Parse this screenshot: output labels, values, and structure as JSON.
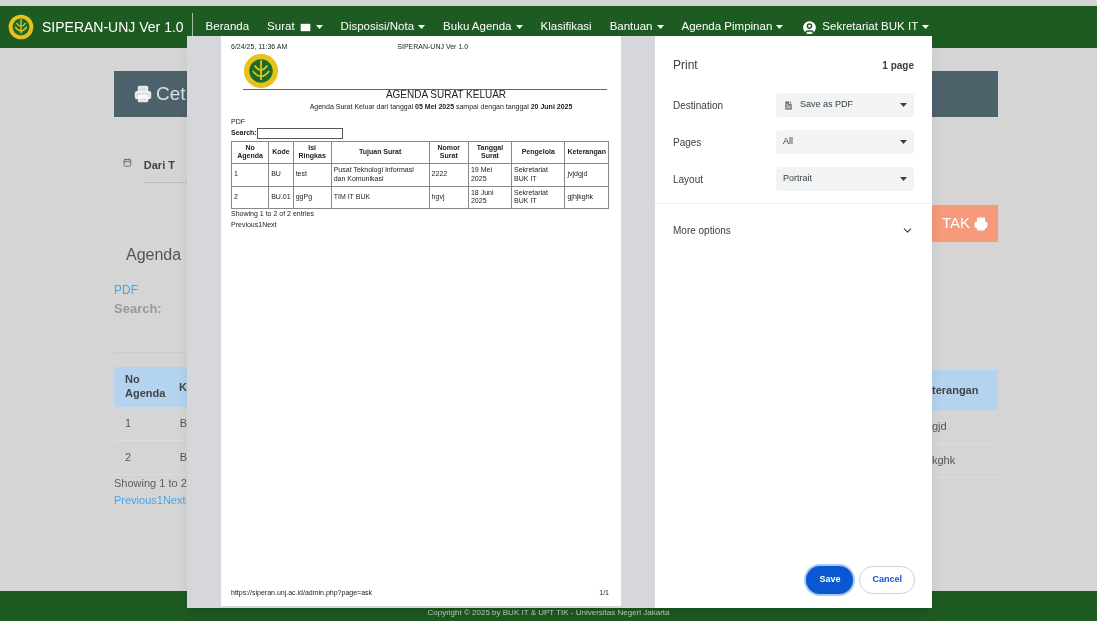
{
  "navbar": {
    "brand": "SIPERAN-UNJ Ver 1.0",
    "items": [
      {
        "label": "Beranda",
        "kind": "plain",
        "dropdown": false
      },
      {
        "label": "Surat",
        "kind": "mail",
        "dropdown": true
      },
      {
        "label": "Disposisi/Nota",
        "kind": "plain",
        "dropdown": true
      },
      {
        "label": "Buku Agenda",
        "kind": "plain",
        "dropdown": true
      },
      {
        "label": "Klasifikasi",
        "kind": "plain",
        "dropdown": false
      },
      {
        "label": "Bantuan",
        "kind": "plain",
        "dropdown": true
      },
      {
        "label": "Agenda Pimpinan",
        "kind": "plain",
        "dropdown": true
      },
      {
        "label": "Sekretariat BUK IT",
        "kind": "account",
        "dropdown": true
      }
    ]
  },
  "background": {
    "left": {
      "print_button": "Cet",
      "date_label": "Dari T",
      "title": "Agenda",
      "pdf_link": "PDF",
      "search_label": "Search:",
      "header": [
        "No Agenda",
        "K"
      ],
      "rows": [
        [
          "1",
          "B"
        ],
        [
          "2",
          "B"
        ]
      ],
      "info": "Showing 1 to 2",
      "pager": "Previous1Next"
    },
    "right": {
      "print_button": "TAK",
      "header": "terangan",
      "rows": [
        "gjd",
        "kghk"
      ]
    },
    "footer": "Copyright © 2025 by BUK IT & UPT TIK - Universitas Negeri Jakarta"
  },
  "print_preview": {
    "header_left": "6/24/25, 11:36 AM",
    "header_center": "SIPERAN-UNJ Ver 1.0",
    "title": "AGENDA SURAT KELUAR",
    "subtitle": "Agenda Surat Keluar dari tanggal **05 Mei 2025** sampai dengan tanggal **20 Juni 2025**",
    "pdf_link": "PDF",
    "search_label": "Search:",
    "columns": [
      "No Agenda",
      "Kode",
      "Isi Ringkas",
      "Tujuan Surat",
      "Nomor Surat",
      "Tanggal Surat",
      "Pengelola",
      "Keterangan"
    ],
    "rows": [
      [
        "1",
        "BU",
        "test",
        "Pusat Teknologi Informasi dan Komunikasi",
        "2222",
        "19 Mei 2025",
        "Sekretariat BUK IT",
        "jvjdgjd"
      ],
      [
        "2",
        "BU.01",
        "ggPg",
        "TIM IT BUK",
        "hgvj",
        "18 Juni 2025",
        "Sekretariat BUK IT",
        "gjhjkghk"
      ]
    ],
    "info": "Showing 1 to 2 of 2 entries",
    "pager": "Previous1Next",
    "footer_url": "https://siperan.unj.ac.id/admin.php?page=ask",
    "footer_page": "1/1"
  },
  "print_settings": {
    "title": "Print",
    "page_count": "1 page",
    "fields": [
      {
        "label": "Destination",
        "value": "Save as PDF",
        "kind": "destination"
      },
      {
        "label": "Pages",
        "value": "All",
        "kind": "plain"
      },
      {
        "label": "Layout",
        "value": "Portrait",
        "kind": "plain"
      }
    ],
    "more_options": "More options",
    "buttons": [
      {
        "label": "Save",
        "kind": "primary"
      },
      {
        "label": "Cancel",
        "kind": "secondary"
      }
    ]
  }
}
